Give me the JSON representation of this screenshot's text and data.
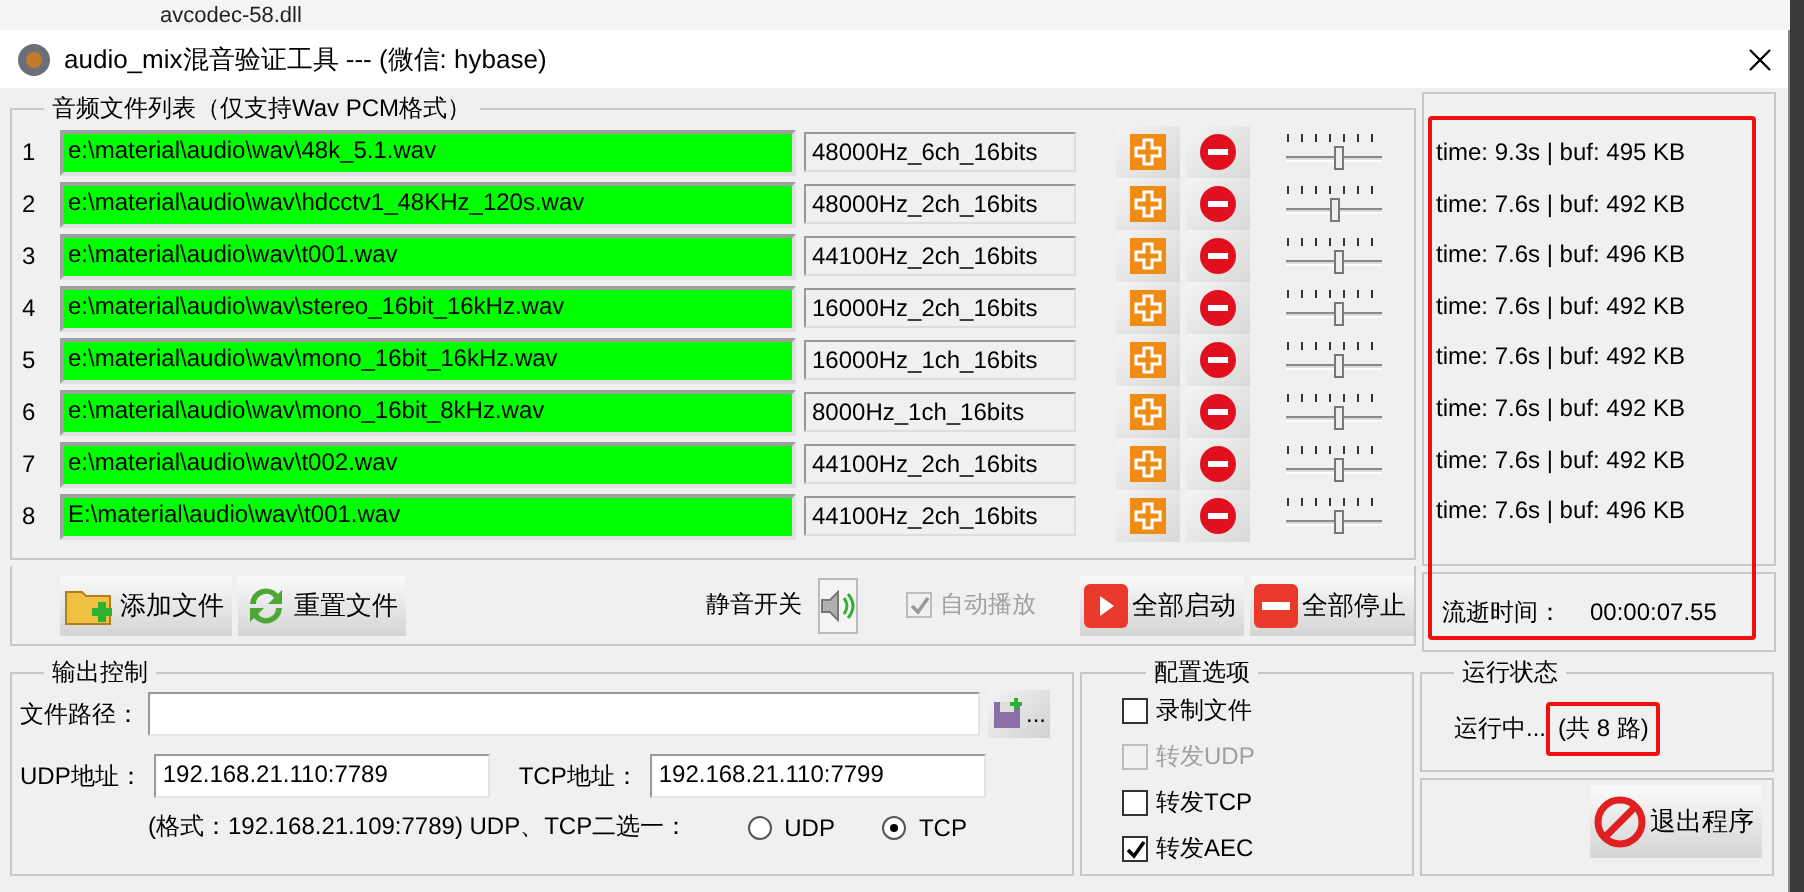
{
  "background": {
    "file_name": "avcodec-58.dll"
  },
  "window": {
    "title": "audio_mix混音验证工具 --- (微信: hybase)"
  },
  "file_list": {
    "title": "音频文件列表（仅支持Wav PCM格式）",
    "rows": [
      {
        "index": "1",
        "path": "e:\\material\\audio\\wav\\48k_5.1.wav",
        "format": "48000Hz_6ch_16bits",
        "level": 0.55
      },
      {
        "index": "2",
        "path": "e:\\material\\audio\\wav\\hdcctv1_48KHz_120s.wav",
        "format": "48000Hz_2ch_16bits",
        "level": 0.5
      },
      {
        "index": "3",
        "path": "e:\\material\\audio\\wav\\t001.wav",
        "format": "44100Hz_2ch_16bits",
        "level": 0.55
      },
      {
        "index": "4",
        "path": "e:\\material\\audio\\wav\\stereo_16bit_16kHz.wav",
        "format": "16000Hz_2ch_16bits",
        "level": 0.55
      },
      {
        "index": "5",
        "path": "e:\\material\\audio\\wav\\mono_16bit_16kHz.wav",
        "format": "16000Hz_1ch_16bits",
        "level": 0.55
      },
      {
        "index": "6",
        "path": "e:\\material\\audio\\wav\\mono_16bit_8kHz.wav",
        "format": "8000Hz_1ch_16bits",
        "level": 0.55
      },
      {
        "index": "7",
        "path": "e:\\material\\audio\\wav\\t002.wav",
        "format": "44100Hz_2ch_16bits",
        "level": 0.55
      },
      {
        "index": "8",
        "path": "E:\\material\\audio\\wav\\t001.wav",
        "format": "44100Hz_2ch_16bits",
        "level": 0.55
      }
    ]
  },
  "stats": [
    "time: 9.3s | buf: 495 KB",
    "time: 7.6s | buf: 492 KB",
    "time: 7.6s | buf: 496 KB",
    "time: 7.6s | buf: 492 KB",
    "time: 7.6s | buf: 492 KB",
    "time: 7.6s | buf: 492 KB",
    "time: 7.6s | buf: 492 KB",
    "time: 7.6s | buf: 496 KB"
  ],
  "toolbar": {
    "add_button": "添加文件",
    "reset_button": "重置文件",
    "mute_label": "静音开关",
    "auto_play": {
      "label": "自动播放",
      "checked": true,
      "disabled": true
    },
    "start_button": "全部启动",
    "stop_button": "全部停止"
  },
  "elapsed": {
    "label": "流逝时间：",
    "value": "00:00:07.55"
  },
  "output": {
    "title": "输出控制",
    "file_path_label": "文件路径：",
    "browse": "...",
    "udp_label": "UDP地址：",
    "udp_value": "192.168.21.110:7789",
    "tcp_label": "TCP地址：",
    "tcp_value": "192.168.21.110:7799",
    "hint": "(格式：192.168.21.109:7789) UDP、TCP二选一：",
    "protocols": [
      {
        "label": "UDP",
        "selected": false
      },
      {
        "label": "TCP",
        "selected": true
      }
    ]
  },
  "config": {
    "title": "配置选项",
    "options": [
      {
        "label": "录制文件",
        "checked": false,
        "disabled": false
      },
      {
        "label": "转发UDP",
        "checked": false,
        "disabled": true
      },
      {
        "label": "转发TCP",
        "checked": false,
        "disabled": false
      },
      {
        "label": "转发AEC",
        "checked": true,
        "disabled": false
      }
    ]
  },
  "status": {
    "title": "运行状态",
    "text": "运行中...",
    "count": "(共 8 路)"
  },
  "exit_button": "退出程序"
}
